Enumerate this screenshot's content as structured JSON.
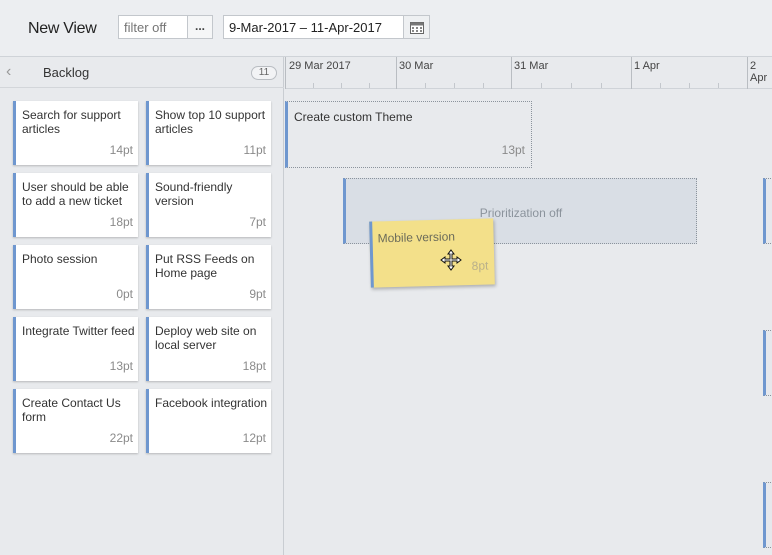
{
  "header": {
    "view_title": "New View",
    "filter_placeholder": "filter off",
    "more_label": "...",
    "date_range": "9-Mar-2017 – 11-Apr-2017"
  },
  "backlog": {
    "title": "Backlog",
    "count": "11",
    "cards": [
      {
        "title": "Search for support articles",
        "points": "14pt"
      },
      {
        "title": "Show top 10 support articles",
        "points": "11pt"
      },
      {
        "title": "User should be able to add a new ticket",
        "points": "18pt"
      },
      {
        "title": "Sound-friendly version",
        "points": "7pt"
      },
      {
        "title": "Photo session",
        "points": "0pt"
      },
      {
        "title": "Put RSS Feeds on Home page",
        "points": "9pt"
      },
      {
        "title": "Integrate Twitter feed",
        "points": "13pt"
      },
      {
        "title": "Deploy web site on local server",
        "points": "18pt"
      },
      {
        "title": "Create Contact Us form",
        "points": "22pt"
      },
      {
        "title": "Facebook integration",
        "points": "12pt"
      }
    ]
  },
  "timeline": {
    "dates": [
      "29 Mar 2017",
      "30 Mar",
      "31 Mar",
      "1 Apr",
      "2 Apr"
    ],
    "cards": [
      {
        "title": "Create custom Theme",
        "points": "13pt"
      }
    ],
    "ghost_text": "Prioritization off",
    "dragging_card": {
      "title": "Mobile version",
      "points": "8pt"
    }
  },
  "colors": {
    "accent": "#6f97cf",
    "drag_card": "#f3e08a",
    "background": "#e8eaed"
  }
}
